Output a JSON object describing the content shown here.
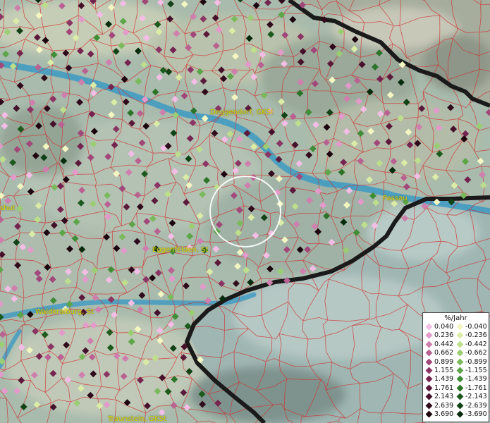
{
  "map": {
    "cities": [
      {
        "name": "Deggendorf, GKSt"
      },
      {
        "name": "Passau"
      },
      {
        "name": "Eggenfelden, St"
      },
      {
        "name": "Waldkraiburg, St"
      },
      {
        "name": "Traunstein, GKSt"
      },
      {
        "name": "shut"
      }
    ],
    "colors": {
      "river": "#3d9ac3",
      "border": "#1a1a1a",
      "municipal_lines": "#d22c2c",
      "label": "#d8d200"
    }
  },
  "legend": {
    "title": "%/Jahr",
    "positive": [
      {
        "label": "0.040",
        "color": "#f3bde6"
      },
      {
        "label": "0.236",
        "color": "#e39acb"
      },
      {
        "label": "0.442",
        "color": "#cf7fae"
      },
      {
        "label": "0.662",
        "color": "#b96292"
      },
      {
        "label": "0.899",
        "color": "#a1477a"
      },
      {
        "label": "1.155",
        "color": "#8a3563"
      },
      {
        "label": "1.439",
        "color": "#74244f"
      },
      {
        "label": "1.761",
        "color": "#5c1a3b"
      },
      {
        "label": "2.143",
        "color": "#45112a"
      },
      {
        "label": "2.639",
        "color": "#2f0a1b"
      },
      {
        "label": "3.690",
        "color": "#1c050f"
      }
    ],
    "negative": [
      {
        "label": "-0.040",
        "color": "#f4f6c2"
      },
      {
        "label": "-0.236",
        "color": "#dbeca6"
      },
      {
        "label": "-0.442",
        "color": "#bddf8c"
      },
      {
        "label": "-0.662",
        "color": "#9bcd73"
      },
      {
        "label": "-0.899",
        "color": "#7bba5c"
      },
      {
        "label": "-1.155",
        "color": "#5ca548"
      },
      {
        "label": "-1.439",
        "color": "#408d37"
      },
      {
        "label": "-1.761",
        "color": "#2c7429"
      },
      {
        "label": "-2.143",
        "color": "#1c5b1d"
      },
      {
        "label": "-2.639",
        "color": "#104215"
      },
      {
        "label": "-3.690",
        "color": "#072b0c"
      }
    ]
  }
}
